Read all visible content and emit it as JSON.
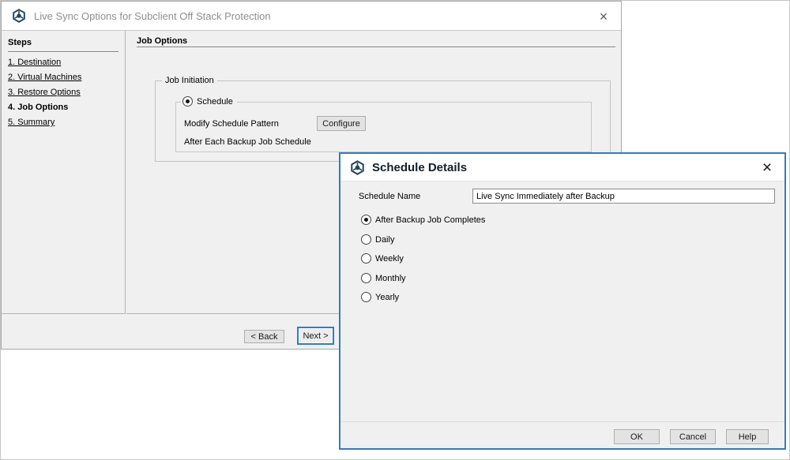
{
  "colors": {
    "dialog_body_gray": "#f0f0f0",
    "active_dialog_border_blue": "#2d7dc6",
    "focused_button_border_blue": "#2b7cd3",
    "inactive_title_text": "#8f8f8f",
    "logo_navy": "#1f4461"
  },
  "live_sync_dialog": {
    "title": "Live Sync Options for Subclient Off Stack Protection",
    "close_glyph": "×",
    "steps_header": "Steps",
    "steps": [
      {
        "label": "1. Destination",
        "current": false
      },
      {
        "label": "2. Virtual Machines",
        "current": false
      },
      {
        "label": "3. Restore Options",
        "current": false
      },
      {
        "label": "4. Job Options",
        "current": true
      },
      {
        "label": "5. Summary",
        "current": false
      }
    ],
    "page_title": "Job Options",
    "job_initiation": {
      "group_label": "Job Initiation",
      "schedule_radio_label": "Schedule",
      "schedule_radio_selected": true,
      "modify_label": "Modify Schedule Pattern",
      "configure_button": "Configure",
      "after_backup_label": "After Each Backup Job Schedule"
    },
    "back_button": "< Back",
    "next_button": "Next >"
  },
  "schedule_details_dialog": {
    "title": "Schedule Details",
    "close_glyph": "×",
    "schedule_name_label": "Schedule Name",
    "schedule_name_value": "Live Sync Immediately after Backup",
    "frequency_options": [
      {
        "label": "After Backup Job Completes",
        "selected": true
      },
      {
        "label": "Daily",
        "selected": false
      },
      {
        "label": "Weekly",
        "selected": false
      },
      {
        "label": "Monthly",
        "selected": false
      },
      {
        "label": "Yearly",
        "selected": false
      }
    ],
    "ok_button": "OK",
    "cancel_button": "Cancel",
    "help_button": "Help"
  }
}
